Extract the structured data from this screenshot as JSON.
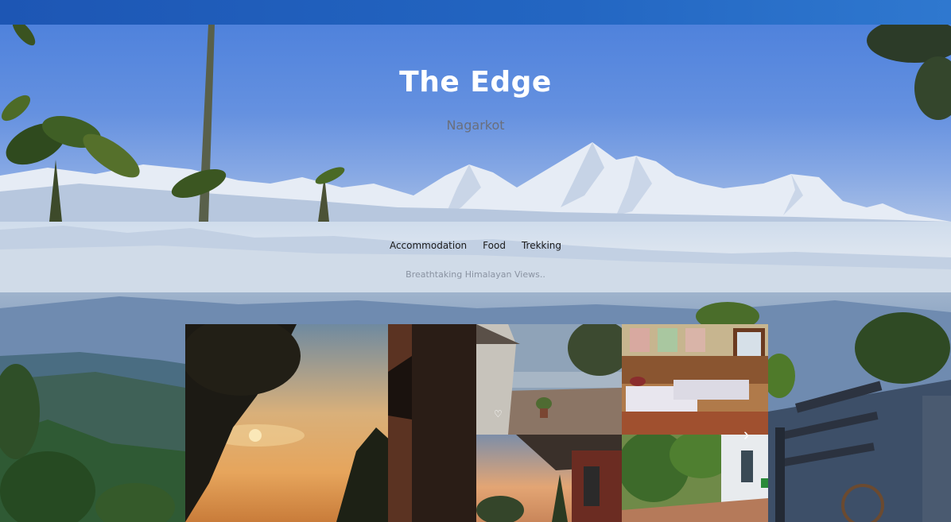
{
  "header": {
    "title": "The Edge",
    "subtitle": "Nagarkot"
  },
  "nav": {
    "items": [
      {
        "label": "Accommodation"
      },
      {
        "label": "Food"
      },
      {
        "label": "Trekking"
      }
    ],
    "tagline": "Breathtaking Himalayan Views.."
  },
  "gallery": {
    "heart_icon": "heart-icon",
    "arrow_icon": "chevron-right-icon"
  },
  "colors": {
    "topbar": "#1d56b4",
    "sky": "#5b8ade",
    "title_text": "#ffffff",
    "subtitle_text": "#6a6f7c"
  }
}
